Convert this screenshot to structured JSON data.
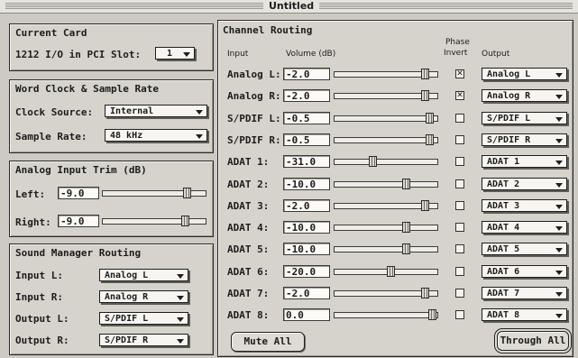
{
  "window": {
    "title": "Untitled"
  },
  "current_card": {
    "title": "Current Card",
    "label": "1212 I/O in PCI Slot:",
    "slot": "1"
  },
  "word_clock": {
    "title": "Word Clock & Sample Rate",
    "clock_label": "Clock Source:",
    "clock_value": "Internal",
    "rate_label": "Sample Rate:",
    "rate_value": "48 kHz"
  },
  "analog_trim": {
    "title": "Analog Input Trim (dB)",
    "left_label": "Left:",
    "left_value": "-9.0",
    "right_label": "Right:",
    "right_value": "-9.0",
    "left_level": 0.82,
    "right_level": 0.8
  },
  "sound_manager": {
    "title": "Sound Manager Routing",
    "rows": [
      {
        "label": "Input L:",
        "value": "Analog L"
      },
      {
        "label": "Input R:",
        "value": "Analog R"
      },
      {
        "label": "Output L:",
        "value": "S/PDIF L"
      },
      {
        "label": "Output R:",
        "value": "S/PDIF R"
      }
    ]
  },
  "channel_routing": {
    "title": "Channel Routing",
    "headers": {
      "input": "Input",
      "volume": "Volume (dB)",
      "phase_line1": "Phase",
      "phase_line2": "Invert",
      "output": "Output"
    },
    "rows": [
      {
        "label": "Analog L:",
        "volume": "-2.0",
        "level": 0.88,
        "phase": true,
        "output": "Analog L"
      },
      {
        "label": "Analog R:",
        "volume": "-2.0",
        "level": 0.88,
        "phase": true,
        "output": "Analog R"
      },
      {
        "label": "S/PDIF L:",
        "volume": "-0.5",
        "level": 0.92,
        "phase": false,
        "output": "S/PDIF L"
      },
      {
        "label": "S/PDIF R:",
        "volume": "-0.5",
        "level": 0.92,
        "phase": false,
        "output": "S/PDIF R"
      },
      {
        "label": "ADAT 1:",
        "volume": "-31.0",
        "level": 0.38,
        "phase": false,
        "output": "ADAT 1"
      },
      {
        "label": "ADAT 2:",
        "volume": "-10.0",
        "level": 0.7,
        "phase": false,
        "output": "ADAT 2"
      },
      {
        "label": "ADAT 3:",
        "volume": "-2.0",
        "level": 0.88,
        "phase": false,
        "output": "ADAT 3"
      },
      {
        "label": "ADAT 4:",
        "volume": "-10.0",
        "level": 0.7,
        "phase": false,
        "output": "ADAT 4"
      },
      {
        "label": "ADAT 5:",
        "volume": "-10.0",
        "level": 0.7,
        "phase": false,
        "output": "ADAT 5"
      },
      {
        "label": "ADAT 6:",
        "volume": "-20.0",
        "level": 0.55,
        "phase": false,
        "output": "ADAT 6"
      },
      {
        "label": "ADAT 7:",
        "volume": "-2.0",
        "level": 0.88,
        "phase": false,
        "output": "ADAT 7"
      },
      {
        "label": "ADAT 8:",
        "volume": "0.0",
        "level": 0.95,
        "phase": false,
        "output": "ADAT 8"
      }
    ],
    "mute_all": "Mute All",
    "through_all": "Through All"
  },
  "icons": {
    "popup": "chevron-down-icon",
    "phase_checked": "x-mark-icon"
  }
}
